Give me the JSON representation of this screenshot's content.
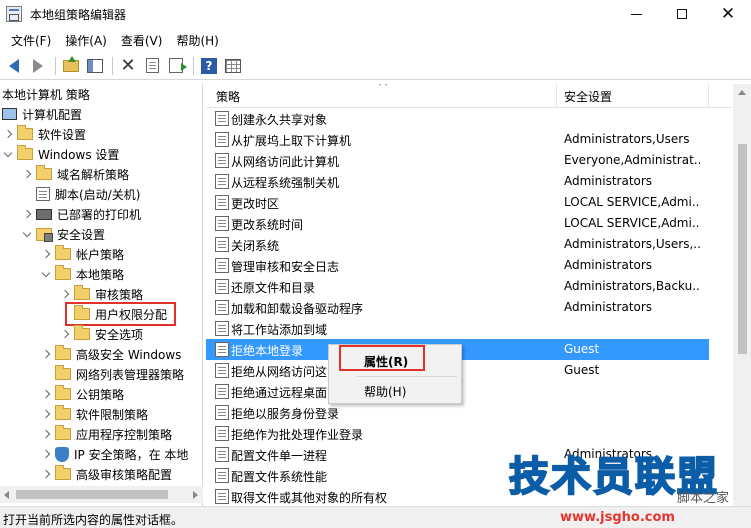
{
  "window": {
    "title": "本地组策略编辑器"
  },
  "menu": [
    "文件(F)",
    "操作(A)",
    "查看(V)",
    "帮助(H)"
  ],
  "tree": {
    "root": "本地计算机 策略",
    "items": [
      {
        "label": "计算机配置"
      },
      {
        "label": "软件设置"
      },
      {
        "label": "Windows 设置"
      },
      {
        "label": "域名解析策略"
      },
      {
        "label": "脚本(启动/关机)"
      },
      {
        "label": "已部署的打印机"
      },
      {
        "label": "安全设置"
      },
      {
        "label": "帐户策略"
      },
      {
        "label": "本地策略"
      },
      {
        "label": "审核策略"
      },
      {
        "label": "用户权限分配"
      },
      {
        "label": "安全选项"
      },
      {
        "label": "高级安全 Windows"
      },
      {
        "label": "网络列表管理器策略"
      },
      {
        "label": "公钥策略"
      },
      {
        "label": "软件限制策略"
      },
      {
        "label": "应用程序控制策略"
      },
      {
        "label": "IP 安全策略，在 本地"
      },
      {
        "label": "高级审核策略配置"
      }
    ]
  },
  "list": {
    "columns": [
      "策略",
      "安全设置"
    ],
    "rows": [
      {
        "name": "创建永久共享对象",
        "value": ""
      },
      {
        "name": "从扩展坞上取下计算机",
        "value": "Administrators,Users"
      },
      {
        "name": "从网络访问此计算机",
        "value": "Everyone,Administrat..."
      },
      {
        "name": "从远程系统强制关机",
        "value": "Administrators"
      },
      {
        "name": "更改时区",
        "value": "LOCAL SERVICE,Admi..."
      },
      {
        "name": "更改系统时间",
        "value": "LOCAL SERVICE,Admi..."
      },
      {
        "name": "关闭系统",
        "value": "Administrators,Users,..."
      },
      {
        "name": "管理审核和安全日志",
        "value": "Administrators"
      },
      {
        "name": "还原文件和目录",
        "value": "Administrators,Backu..."
      },
      {
        "name": "加载和卸载设备驱动程序",
        "value": "Administrators"
      },
      {
        "name": "将工作站添加到域",
        "value": ""
      },
      {
        "name": "拒绝本地登录",
        "value": "Guest"
      },
      {
        "name": "拒绝从网络访问这",
        "value": "Guest"
      },
      {
        "name": "拒绝通过远程桌面",
        "value": ""
      },
      {
        "name": "拒绝以服务身份登录",
        "value": ""
      },
      {
        "name": "拒绝作为批处理作业登录",
        "value": ""
      },
      {
        "name": "配置文件单一进程",
        "value": "Administrators"
      },
      {
        "name": "配置文件系统性能",
        "value": ""
      },
      {
        "name": "取得文件或其他对象的所有权",
        "value": ""
      }
    ]
  },
  "context_menu": {
    "properties": "属性(R)",
    "help": "帮助(H)"
  },
  "status": "打开当前所选内容的属性对话框。",
  "watermark": {
    "main": "技术员联盟",
    "sub": "脚本之家",
    "url": "www.jsgho.com"
  },
  "colors": {
    "selection": "#3399ff",
    "highlight_box": "#e0312d",
    "watermark": "#1d8fe0"
  }
}
